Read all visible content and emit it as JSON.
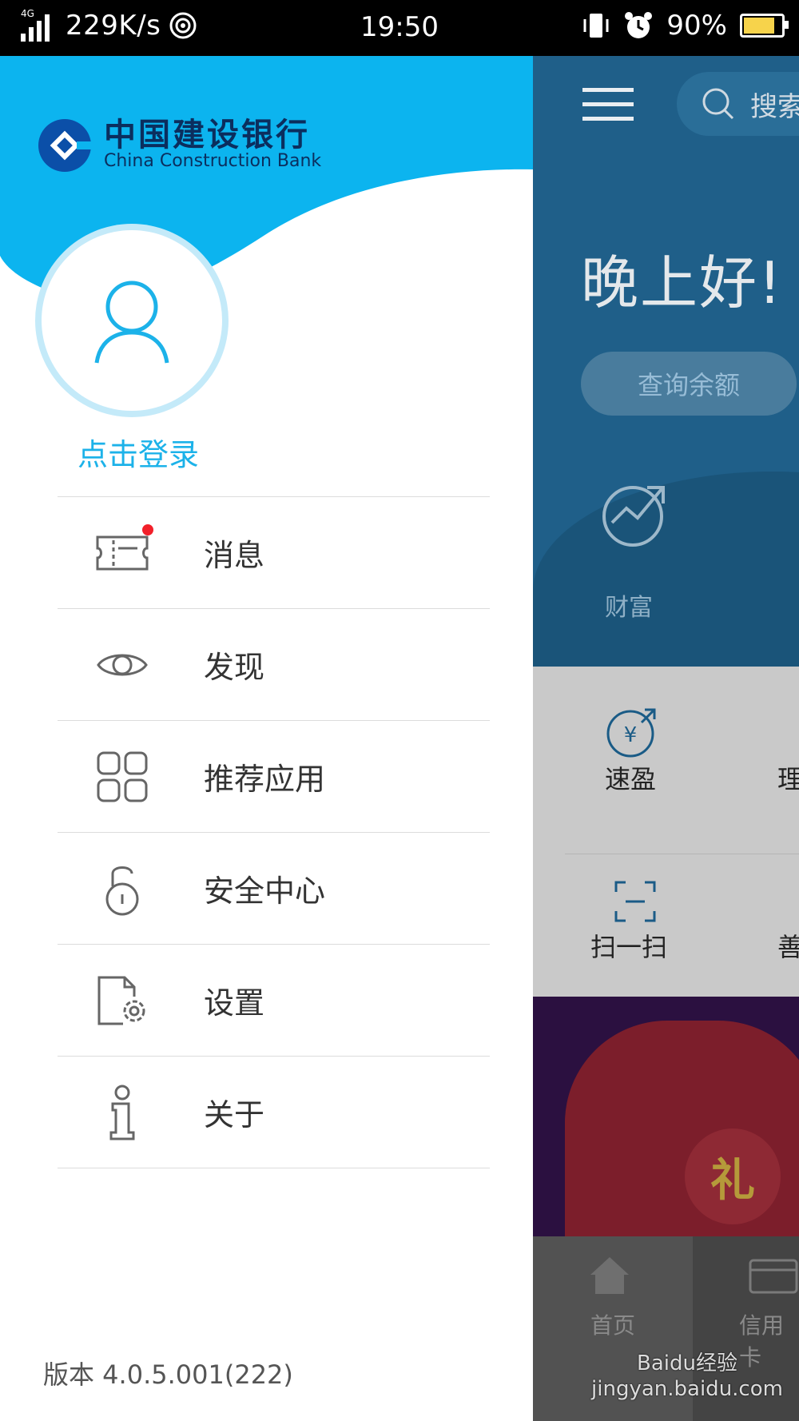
{
  "status_bar": {
    "network": "4G",
    "speed": "229K/s",
    "time": "19:50",
    "battery": "90%"
  },
  "drawer": {
    "logo": {
      "name_cn": "中国建设银行",
      "name_en": "China Construction Bank"
    },
    "login_label": "点击登录",
    "menu": [
      {
        "label": "消息",
        "icon": "ticket-icon",
        "has_badge": true
      },
      {
        "label": "发现",
        "icon": "eye-icon"
      },
      {
        "label": "推荐应用",
        "icon": "grid-apps-icon"
      },
      {
        "label": "安全中心",
        "icon": "unlock-icon"
      },
      {
        "label": "设置",
        "icon": "settings-document-icon"
      },
      {
        "label": "关于",
        "icon": "info-icon"
      }
    ],
    "version": "版本 4.0.5.001(222)"
  },
  "background_app": {
    "search_placeholder": "搜索",
    "greeting": "晚上好!",
    "balance_button": "查询余额",
    "wealth_label": "财富",
    "quick_items": [
      "速盈",
      "理",
      "扫一扫",
      "善"
    ],
    "gift_char": "礼",
    "tabs": [
      "首页",
      "信用卡"
    ]
  },
  "watermark": "Baidu经验 jingyan.baidu.com",
  "colors": {
    "accent": "#1cb2e9",
    "header_blue": "#0cb4ef",
    "badge_red": "#f2202a"
  }
}
